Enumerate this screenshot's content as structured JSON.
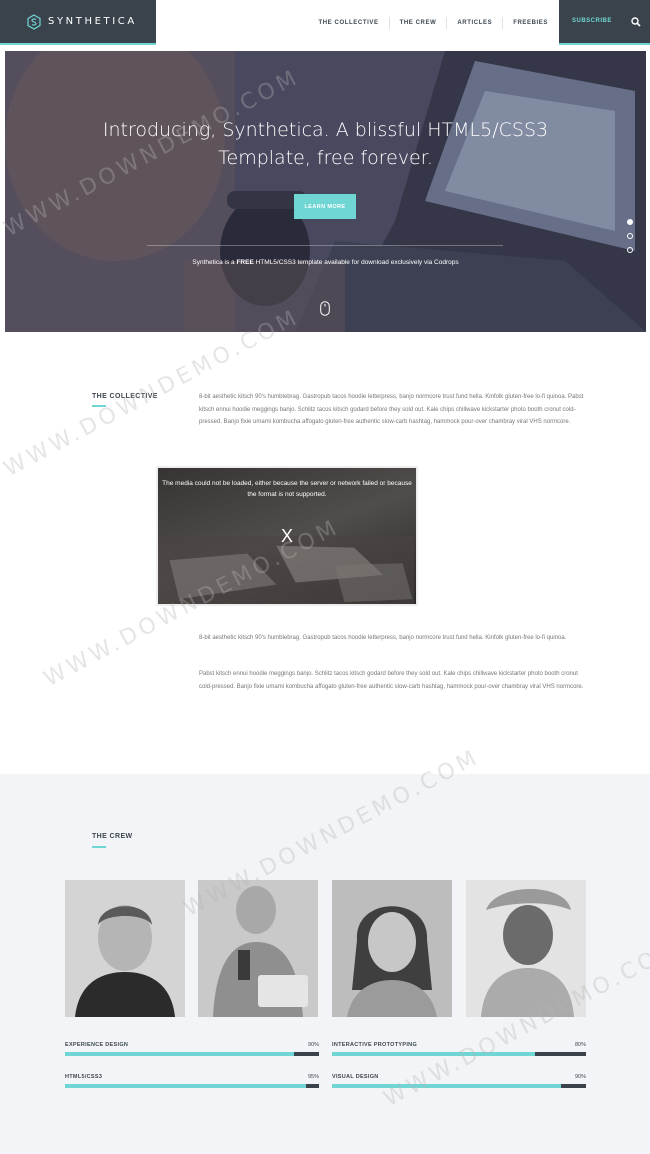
{
  "nav": {
    "brand": "SYNTHETICA",
    "items": [
      "THE COLLECTIVE",
      "THE CREW",
      "ARTICLES",
      "FREEBIES"
    ],
    "subscribe": "SUBSCRIBE",
    "accent": "#6fd6d4",
    "dark": "#3a434b"
  },
  "hero": {
    "title_line1": "Introducing, Synthetica. A blissful HTML5/CSS3",
    "title_line2": "Template, free forever.",
    "button": "LEARN MORE",
    "sub_prefix": "Synthetica is a ",
    "sub_bold": "FREE",
    "sub_suffix": " HTML5/CSS3 template available for download exclusively via Codrops",
    "slides": 3,
    "active_slide": 1
  },
  "collective": {
    "label": "THE COLLECTIVE",
    "p1": "8-bit aesthetic kitsch 90's humblebrag. Gastropub tacos hoodie letterpress, banjo normcore trust fund hella. Kinfolk gluten-free lo-fi quinoa. Pabst kitsch ennui hoodie meggings banjo. Schlitz tacos kitsch godard before they sold out. Kale chips chillwave kickstarter photo booth cronut cold-pressed. Banjo fixie umami kombucha affogato gluten-free authentic slow-carb hashtag, hammock pour-over chambray viral VHS normcore.",
    "video_msg": "The media could not be loaded, either because the server or network failed or because the format is not supported.",
    "video_x": "X",
    "p2": "8-bit aesthetic kitsch 90's humblebrag. Gastropub tacos hoodie letterpress, banjo normcore trust fund hella. Kinfolk gluten-free lo-fi quinoa.",
    "p3": "Pabst kitsch ennui hoodie meggings banjo. Schlitz tacos kitsch godard before they sold out. Kale chips chillwave kickstarter photo booth cronut cold-pressed. Banjo fixie umami kombucha affogato gluten-free authentic slow-carb hashtag, hammock pour-over chambray viral VHS normcore."
  },
  "crew": {
    "label": "THE CREW",
    "skills": [
      {
        "name": "EXPERIENCE DESIGN",
        "pct": "90%",
        "value": 0.9
      },
      {
        "name": "INTERACTIVE PROTOTYPING",
        "pct": "80%",
        "value": 0.8
      },
      {
        "name": "HTML5/CSS3",
        "pct": "95%",
        "value": 0.95
      },
      {
        "name": "VISUAL DESIGN",
        "pct": "90%",
        "value": 0.9
      }
    ]
  },
  "watermark": "WWW.DOWNDEMO.COM"
}
